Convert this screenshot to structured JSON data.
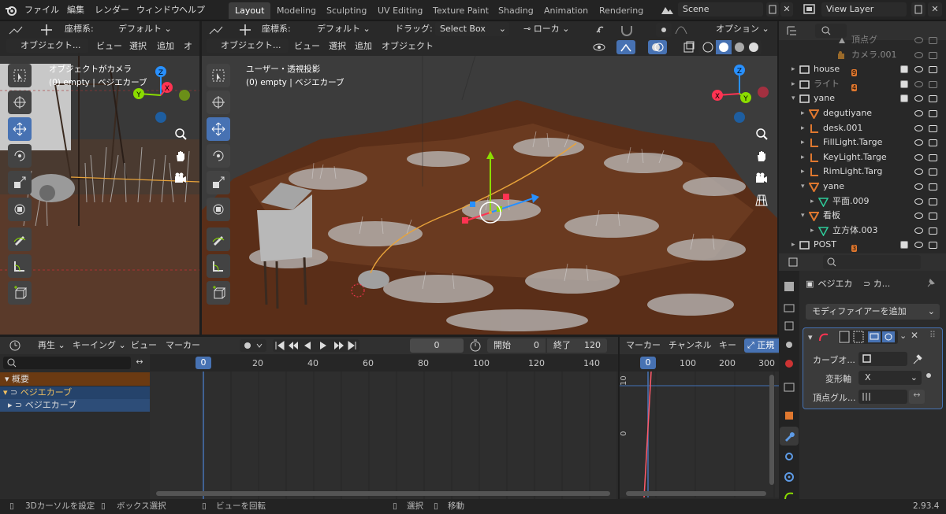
{
  "topbar": {
    "menus": [
      "ファイル",
      "編集",
      "レンダー",
      "ウィンドウ",
      "ヘルプ"
    ],
    "workspaces": [
      "Layout",
      "Modeling",
      "Sculpting",
      "UV Editing",
      "Texture Paint",
      "Shading",
      "Animation",
      "Rendering"
    ],
    "active_workspace": "Layout",
    "scene": "Scene",
    "view_layer": "View Layer"
  },
  "left_view": {
    "coord_label": "座標系:",
    "coord_value": "デフォルト",
    "mode": "オブジェクト...",
    "menus": [
      "ビュー",
      "選択",
      "追加",
      "オ"
    ],
    "title": "オブジェクトがカメラ",
    "subtitle": "(0) empty | ベジエカーブ"
  },
  "main_view": {
    "coord_label": "座標系:",
    "coord_value": "デフォルト",
    "drag_label": "ドラッグ:",
    "drag_value": "Select Box",
    "pivot": "ローカ",
    "options": "オプション",
    "mode": "オブジェクト...",
    "menus": [
      "ビュー",
      "選択",
      "追加",
      "オブジェクト"
    ],
    "title": "ユーザー・透視投影",
    "subtitle": "(0) empty | ベジエカーブ"
  },
  "gizmo_axes": {
    "x": "X",
    "y": "Y",
    "z": "Z"
  },
  "outliner": {
    "rows": [
      {
        "label": "頂点グ",
        "dim": true,
        "icon": "vertex-group-icon",
        "indent": 5
      },
      {
        "label": "カメラ.001",
        "dim": true,
        "icon": "camera-data-icon",
        "indent": 5
      },
      {
        "label": "house",
        "dim": false,
        "icon": "collection-icon",
        "indent": 1,
        "badge": "9",
        "check": true
      },
      {
        "label": "ライト",
        "dim": true,
        "icon": "collection-icon",
        "indent": 1,
        "badge": "4",
        "check": true
      },
      {
        "label": "yane",
        "dim": false,
        "icon": "collection-icon",
        "indent": 1,
        "check": true,
        "open": true
      },
      {
        "label": "degutiyane",
        "dim": false,
        "icon": "mesh-icon",
        "indent": 2
      },
      {
        "label": "desk.001",
        "dim": false,
        "icon": "empty-icon",
        "indent": 2
      },
      {
        "label": "FillLight.Targe",
        "dim": false,
        "icon": "empty-icon",
        "indent": 2
      },
      {
        "label": "KeyLight.Targe",
        "dim": false,
        "icon": "empty-icon",
        "indent": 2
      },
      {
        "label": "RimLight.Targ",
        "dim": false,
        "icon": "empty-icon",
        "indent": 2
      },
      {
        "label": "yane",
        "dim": false,
        "icon": "mesh-icon",
        "indent": 2,
        "open": true
      },
      {
        "label": "平面.009",
        "dim": false,
        "icon": "mesh-data-icon",
        "indent": 3
      },
      {
        "label": "看板",
        "dim": false,
        "icon": "mesh-icon",
        "indent": 2,
        "open": true
      },
      {
        "label": "立方体.003",
        "dim": false,
        "icon": "mesh-data-icon",
        "indent": 3
      },
      {
        "label": "POST",
        "dim": false,
        "icon": "collection-icon",
        "indent": 1,
        "badge": "3",
        "check": true
      }
    ]
  },
  "properties": {
    "object_name": "ベジエカ",
    "data_name": "カ...",
    "add_modifier": "モディファイアーを追加",
    "curve_object_label": "カーブオ...",
    "deform_axis_label": "変形軸",
    "deform_axis_value": "X",
    "vertex_group_label": "頂点グル..."
  },
  "timeline": {
    "menus": [
      "再生",
      "キーイング",
      "ビュー",
      "マーカー"
    ],
    "current_frame": "0",
    "start_label": "開始",
    "start": "0",
    "end_label": "終了",
    "end": "120",
    "ruler": [
      "0",
      "20",
      "40",
      "60",
      "80",
      "100",
      "120",
      "140"
    ],
    "playhead": "0",
    "channels": {
      "summary": "概要",
      "object": "ベジエカーブ",
      "data": "ベジエカーブ"
    }
  },
  "graph": {
    "menus": [
      "マーカー",
      "チャンネル",
      "キー"
    ],
    "normalize": "正規",
    "ruler": [
      "0",
      "100",
      "200",
      "300"
    ],
    "playhead": "0",
    "y_labels": [
      "10",
      "0"
    ]
  },
  "statusbar": {
    "items": [
      "3Dカーソルを設定",
      "ボックス選択",
      "ビューを回転",
      "選択",
      "移動"
    ],
    "version": "2.93.4"
  },
  "colors": {
    "accent": "#4772b3",
    "x_axis": "#ff3352",
    "y_axis": "#8bdc00",
    "z_axis": "#2890ff",
    "curve": "#e8a33a"
  }
}
